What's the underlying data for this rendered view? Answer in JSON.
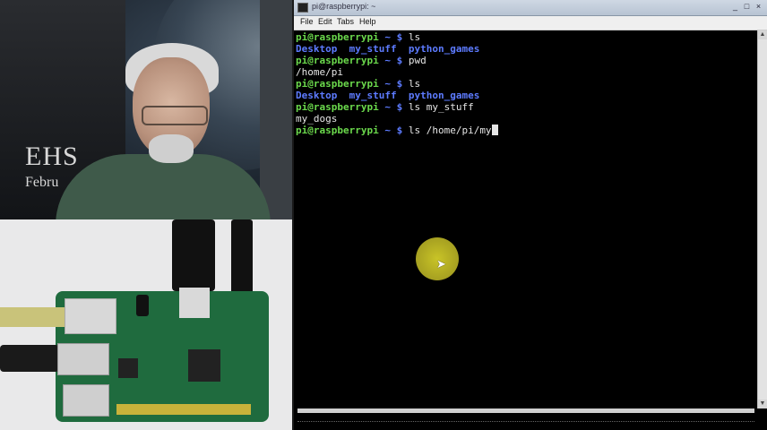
{
  "terminal_window": {
    "title": "pi@raspberrypi: ~",
    "menu": [
      "File",
      "Edit",
      "Tabs",
      "Help"
    ],
    "controls": {
      "minimize": "_",
      "maximize": "□",
      "close": "×"
    },
    "lines": [
      {
        "prompt": "pi@raspberrypi",
        "path": "~ $",
        "command": "ls"
      },
      {
        "output_dirs": [
          "Desktop",
          "my_stuff",
          "python_games"
        ]
      },
      {
        "prompt": "pi@raspberrypi",
        "path": "~ $",
        "command": "pwd"
      },
      {
        "output": "/home/pi"
      },
      {
        "prompt": "pi@raspberrypi",
        "path": "~ $",
        "command": "ls"
      },
      {
        "output_dirs": [
          "Desktop",
          "my_stuff",
          "python_games"
        ]
      },
      {
        "prompt": "pi@raspberrypi",
        "path": "~ $",
        "command": "ls my_stuff"
      },
      {
        "output": "my_dogs"
      },
      {
        "prompt": "pi@raspberrypi",
        "path": "~ $",
        "command": "ls /home/pi/my"
      }
    ]
  },
  "webcam": {
    "poster_text_1": "EHS",
    "poster_text_2": "Febru"
  },
  "colors": {
    "prompt": "#6bd94c",
    "directory": "#5d7bff",
    "text": "#e6e6e6",
    "pointer_highlight": "#c9c427"
  }
}
